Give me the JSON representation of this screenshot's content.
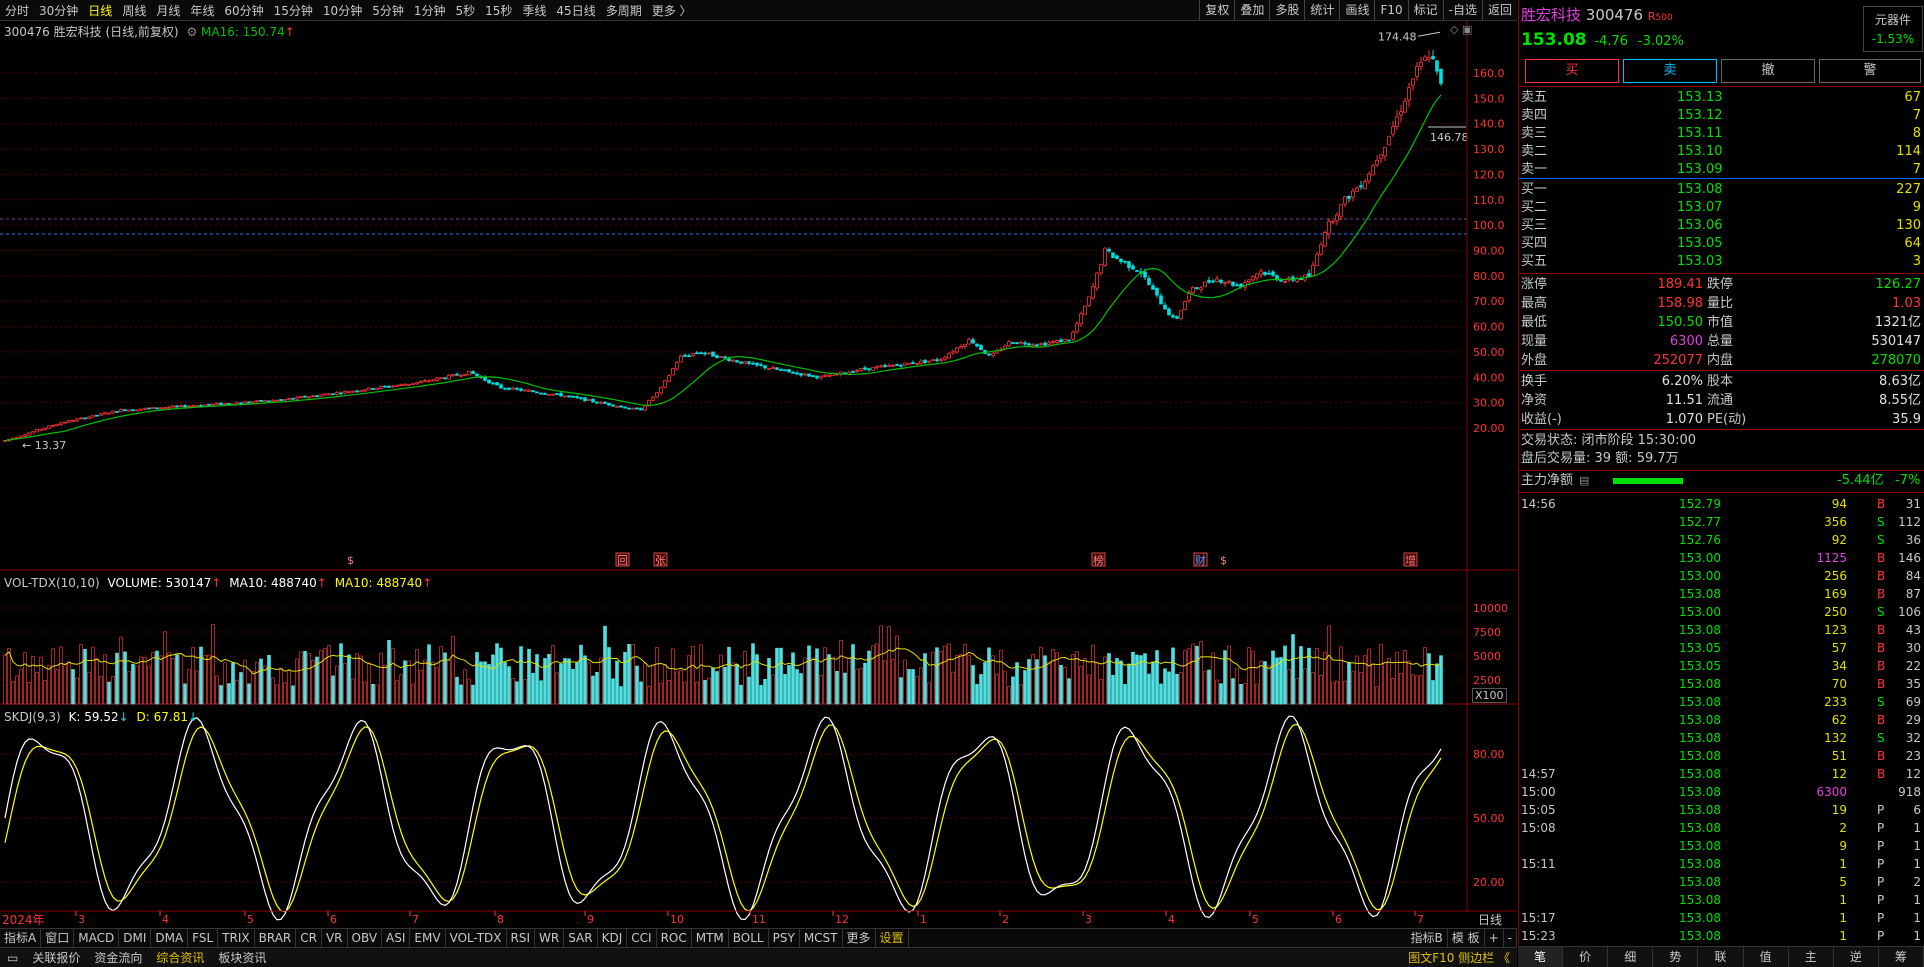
{
  "toolbar": {
    "periods": [
      "分时",
      "30分钟",
      "日线",
      "周线",
      "月线",
      "年线",
      "60分钟",
      "15分钟",
      "10分钟",
      "5分钟",
      "1分钟",
      "5秒",
      "15秒",
      "季线",
      "45日线",
      "多周期",
      "更多 〉"
    ],
    "active_period": "日线",
    "tools": [
      "复权",
      "叠加",
      "多股",
      "统计",
      "画线",
      "F10",
      "标记",
      "-自选",
      "返回"
    ]
  },
  "main_chart": {
    "title": "300476 胜宏科技 (日线,前复权)",
    "ma_label": "MA16: 150.74",
    "ma_arrow": "↑",
    "price_axis": [
      "160.0",
      "150.0",
      "140.0",
      "130.0",
      "120.0",
      "110.0",
      "100.0",
      "90.00",
      "80.00",
      "70.00",
      "60.00",
      "50.00",
      "40.00",
      "30.00",
      "20.00"
    ],
    "high_label": "174.48",
    "low_label": "13.37",
    "last_label": "146.78",
    "event_marks": [
      "$",
      "回",
      "张",
      "榜",
      "财",
      "$",
      "增"
    ],
    "price_min": 13.37,
    "price_max": 174.48
  },
  "volume_chart": {
    "label": "VOL-TDX(10,10)",
    "volume": "VOLUME: 530147",
    "ma10a": "MA10: 488740",
    "ma10b": "MA10: 488740",
    "axis": [
      "10000",
      "7500",
      "5000",
      "2500"
    ],
    "unit": "X100"
  },
  "kdj_chart": {
    "label": "SKDJ(9,3)",
    "k": "K: 59.52",
    "d": "D: 67.81",
    "axis": [
      "80.00",
      "50.00",
      "20.00"
    ]
  },
  "x_axis": {
    "year": "2024年",
    "months": [
      "3",
      "4",
      "5",
      "6",
      "7",
      "8",
      "9",
      "10",
      "11",
      "12",
      "1",
      "2",
      "3",
      "4",
      "5",
      "6",
      "7"
    ],
    "period_label": "日线"
  },
  "indicator_tabs": [
    "指标A",
    "窗口",
    "MACD",
    "DMI",
    "DMA",
    "FSL",
    "TRIX",
    "BRAR",
    "CR",
    "VR",
    "OBV",
    "ASI",
    "EMV",
    "VOL-TDX",
    "RSI",
    "WR",
    "SAR",
    "KDJ",
    "CCI",
    "ROC",
    "MTM",
    "BOLL",
    "PSY",
    "MCST",
    "更多",
    "设置"
  ],
  "indicator_right": [
    "指标B",
    "模 板",
    "+",
    "-"
  ],
  "status_bar": {
    "items": [
      "关联报价",
      "资金流向",
      "综合资讯",
      "板块资讯"
    ],
    "right": "图文F10 侧边栏 《"
  },
  "quote": {
    "name": "胜宏科技",
    "code": "300476",
    "badge": "R",
    "badge2": "500",
    "price": "153.08",
    "change": "-4.76",
    "change_pct": "-3.02%",
    "plugin": "元器件",
    "plugin_pct": "-1.53%",
    "buttons": [
      "买",
      "卖",
      "撤",
      "警"
    ],
    "asks": [
      {
        "label": "卖五",
        "price": "153.13",
        "vol": "67"
      },
      {
        "label": "卖四",
        "price": "153.12",
        "vol": "7"
      },
      {
        "label": "卖三",
        "price": "153.11",
        "vol": "8"
      },
      {
        "label": "卖二",
        "price": "153.10",
        "vol": "114"
      },
      {
        "label": "卖一",
        "price": "153.09",
        "vol": "7"
      }
    ],
    "bids": [
      {
        "label": "买一",
        "price": "153.08",
        "vol": "227"
      },
      {
        "label": "买二",
        "price": "153.07",
        "vol": "9"
      },
      {
        "label": "买三",
        "price": "153.06",
        "vol": "130"
      },
      {
        "label": "买四",
        "price": "153.05",
        "vol": "64"
      },
      {
        "label": "买五",
        "price": "153.03",
        "vol": "3"
      }
    ],
    "stats": [
      {
        "l1": "涨停",
        "v1": "189.41",
        "c1": "#ff3333",
        "l2": "跌停",
        "v2": "126.27",
        "c2": "#00e000"
      },
      {
        "l1": "最高",
        "v1": "158.98",
        "c1": "#ff3333",
        "l2": "量比",
        "v2": "1.03",
        "c2": "#ff3333"
      },
      {
        "l1": "最低",
        "v1": "150.50",
        "c1": "#00e000",
        "l2": "市值",
        "v2": "1321亿",
        "c2": "#e0e0e0"
      },
      {
        "l1": "现量",
        "v1": "6300",
        "c1": "#e040e0",
        "l2": "总量",
        "v2": "530147",
        "c2": "#e0e0e0"
      },
      {
        "l1": "外盘",
        "v1": "252077",
        "c1": "#ff3333",
        "l2": "内盘",
        "v2": "278070",
        "c2": "#00e000"
      }
    ],
    "stats2": [
      {
        "l1": "换手",
        "v1": "6.20%",
        "l2": "股本",
        "v2": "8.63亿"
      },
      {
        "l1": "净资",
        "v1": "11.51",
        "l2": "流通",
        "v2": "8.55亿"
      },
      {
        "l1": "收益(-)",
        "v1": "1.070",
        "l2": "PE(动)",
        "v2": "35.9"
      }
    ],
    "trade_status": "交易状态: 闭市阶段 15:30:00",
    "after_hours": "盘后交易量: 39  额: 59.7万",
    "main_flow_label": "主力净额",
    "main_flow_value": "-5.44亿",
    "main_flow_pct": "-7%"
  },
  "ticks": [
    {
      "t": "14:56",
      "p": "152.79",
      "v": "94",
      "s": "B",
      "n": "31"
    },
    {
      "t": "",
      "p": "152.77",
      "v": "356",
      "s": "S",
      "n": "112"
    },
    {
      "t": "",
      "p": "152.76",
      "v": "92",
      "s": "S",
      "n": "36"
    },
    {
      "t": "",
      "p": "153.00",
      "v": "1125",
      "s": "B",
      "n": "146"
    },
    {
      "t": "",
      "p": "153.00",
      "v": "256",
      "s": "B",
      "n": "84"
    },
    {
      "t": "",
      "p": "153.08",
      "v": "169",
      "s": "B",
      "n": "87"
    },
    {
      "t": "",
      "p": "153.00",
      "v": "250",
      "s": "S",
      "n": "106"
    },
    {
      "t": "",
      "p": "153.08",
      "v": "123",
      "s": "B",
      "n": "43"
    },
    {
      "t": "",
      "p": "153.05",
      "v": "57",
      "s": "B",
      "n": "30"
    },
    {
      "t": "",
      "p": "153.05",
      "v": "34",
      "s": "B",
      "n": "22"
    },
    {
      "t": "",
      "p": "153.08",
      "v": "70",
      "s": "B",
      "n": "35"
    },
    {
      "t": "",
      "p": "153.08",
      "v": "233",
      "s": "S",
      "n": "69"
    },
    {
      "t": "",
      "p": "153.08",
      "v": "62",
      "s": "B",
      "n": "29"
    },
    {
      "t": "",
      "p": "153.08",
      "v": "132",
      "s": "S",
      "n": "32"
    },
    {
      "t": "",
      "p": "153.08",
      "v": "51",
      "s": "B",
      "n": "23"
    },
    {
      "t": "14:57",
      "p": "153.08",
      "v": "12",
      "s": "B",
      "n": "12"
    },
    {
      "t": "15:00",
      "p": "153.08",
      "v": "6300",
      "s": "",
      "n": "918"
    },
    {
      "t": "15:05",
      "p": "153.08",
      "v": "19",
      "s": "P",
      "n": "6"
    },
    {
      "t": "15:08",
      "p": "153.08",
      "v": "2",
      "s": "P",
      "n": "1"
    },
    {
      "t": "",
      "p": "153.08",
      "v": "9",
      "s": "P",
      "n": "1"
    },
    {
      "t": "15:11",
      "p": "153.08",
      "v": "1",
      "s": "P",
      "n": "1"
    },
    {
      "t": "",
      "p": "153.08",
      "v": "5",
      "s": "P",
      "n": "2"
    },
    {
      "t": "",
      "p": "153.08",
      "v": "1",
      "s": "P",
      "n": "1"
    },
    {
      "t": "15:17",
      "p": "153.08",
      "v": "1",
      "s": "P",
      "n": "1"
    },
    {
      "t": "15:23",
      "p": "153.08",
      "v": "1",
      "s": "P",
      "n": "1"
    }
  ],
  "panel_tabs": [
    "笔",
    "价",
    "细",
    "势",
    "联",
    "值",
    "主",
    "逆",
    "筹"
  ],
  "colors": {
    "up": "#ff3333",
    "down": "#00e0e0",
    "ma": "#00c000",
    "k": "#ffffff",
    "d": "#ffff00",
    "grid": "#5a0000"
  }
}
